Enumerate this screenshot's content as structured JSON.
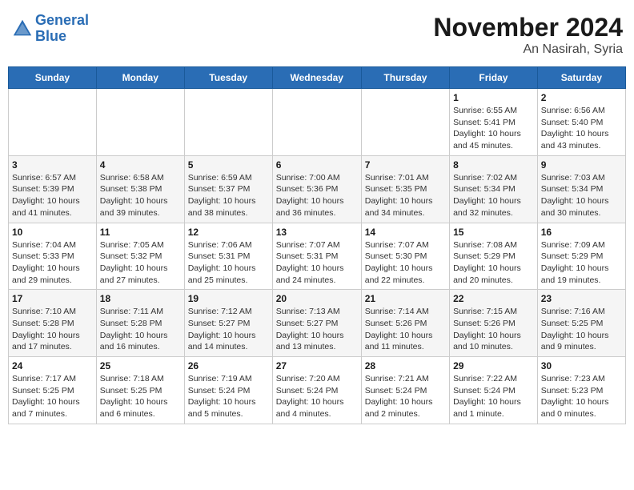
{
  "header": {
    "logo_line1": "General",
    "logo_line2": "Blue",
    "month": "November 2024",
    "location": "An Nasirah, Syria"
  },
  "weekdays": [
    "Sunday",
    "Monday",
    "Tuesday",
    "Wednesday",
    "Thursday",
    "Friday",
    "Saturday"
  ],
  "weeks": [
    [
      {
        "day": "",
        "info": ""
      },
      {
        "day": "",
        "info": ""
      },
      {
        "day": "",
        "info": ""
      },
      {
        "day": "",
        "info": ""
      },
      {
        "day": "",
        "info": ""
      },
      {
        "day": "1",
        "info": "Sunrise: 6:55 AM\nSunset: 5:41 PM\nDaylight: 10 hours\nand 45 minutes."
      },
      {
        "day": "2",
        "info": "Sunrise: 6:56 AM\nSunset: 5:40 PM\nDaylight: 10 hours\nand 43 minutes."
      }
    ],
    [
      {
        "day": "3",
        "info": "Sunrise: 6:57 AM\nSunset: 5:39 PM\nDaylight: 10 hours\nand 41 minutes."
      },
      {
        "day": "4",
        "info": "Sunrise: 6:58 AM\nSunset: 5:38 PM\nDaylight: 10 hours\nand 39 minutes."
      },
      {
        "day": "5",
        "info": "Sunrise: 6:59 AM\nSunset: 5:37 PM\nDaylight: 10 hours\nand 38 minutes."
      },
      {
        "day": "6",
        "info": "Sunrise: 7:00 AM\nSunset: 5:36 PM\nDaylight: 10 hours\nand 36 minutes."
      },
      {
        "day": "7",
        "info": "Sunrise: 7:01 AM\nSunset: 5:35 PM\nDaylight: 10 hours\nand 34 minutes."
      },
      {
        "day": "8",
        "info": "Sunrise: 7:02 AM\nSunset: 5:34 PM\nDaylight: 10 hours\nand 32 minutes."
      },
      {
        "day": "9",
        "info": "Sunrise: 7:03 AM\nSunset: 5:34 PM\nDaylight: 10 hours\nand 30 minutes."
      }
    ],
    [
      {
        "day": "10",
        "info": "Sunrise: 7:04 AM\nSunset: 5:33 PM\nDaylight: 10 hours\nand 29 minutes."
      },
      {
        "day": "11",
        "info": "Sunrise: 7:05 AM\nSunset: 5:32 PM\nDaylight: 10 hours\nand 27 minutes."
      },
      {
        "day": "12",
        "info": "Sunrise: 7:06 AM\nSunset: 5:31 PM\nDaylight: 10 hours\nand 25 minutes."
      },
      {
        "day": "13",
        "info": "Sunrise: 7:07 AM\nSunset: 5:31 PM\nDaylight: 10 hours\nand 24 minutes."
      },
      {
        "day": "14",
        "info": "Sunrise: 7:07 AM\nSunset: 5:30 PM\nDaylight: 10 hours\nand 22 minutes."
      },
      {
        "day": "15",
        "info": "Sunrise: 7:08 AM\nSunset: 5:29 PM\nDaylight: 10 hours\nand 20 minutes."
      },
      {
        "day": "16",
        "info": "Sunrise: 7:09 AM\nSunset: 5:29 PM\nDaylight: 10 hours\nand 19 minutes."
      }
    ],
    [
      {
        "day": "17",
        "info": "Sunrise: 7:10 AM\nSunset: 5:28 PM\nDaylight: 10 hours\nand 17 minutes."
      },
      {
        "day": "18",
        "info": "Sunrise: 7:11 AM\nSunset: 5:28 PM\nDaylight: 10 hours\nand 16 minutes."
      },
      {
        "day": "19",
        "info": "Sunrise: 7:12 AM\nSunset: 5:27 PM\nDaylight: 10 hours\nand 14 minutes."
      },
      {
        "day": "20",
        "info": "Sunrise: 7:13 AM\nSunset: 5:27 PM\nDaylight: 10 hours\nand 13 minutes."
      },
      {
        "day": "21",
        "info": "Sunrise: 7:14 AM\nSunset: 5:26 PM\nDaylight: 10 hours\nand 11 minutes."
      },
      {
        "day": "22",
        "info": "Sunrise: 7:15 AM\nSunset: 5:26 PM\nDaylight: 10 hours\nand 10 minutes."
      },
      {
        "day": "23",
        "info": "Sunrise: 7:16 AM\nSunset: 5:25 PM\nDaylight: 10 hours\nand 9 minutes."
      }
    ],
    [
      {
        "day": "24",
        "info": "Sunrise: 7:17 AM\nSunset: 5:25 PM\nDaylight: 10 hours\nand 7 minutes."
      },
      {
        "day": "25",
        "info": "Sunrise: 7:18 AM\nSunset: 5:25 PM\nDaylight: 10 hours\nand 6 minutes."
      },
      {
        "day": "26",
        "info": "Sunrise: 7:19 AM\nSunset: 5:24 PM\nDaylight: 10 hours\nand 5 minutes."
      },
      {
        "day": "27",
        "info": "Sunrise: 7:20 AM\nSunset: 5:24 PM\nDaylight: 10 hours\nand 4 minutes."
      },
      {
        "day": "28",
        "info": "Sunrise: 7:21 AM\nSunset: 5:24 PM\nDaylight: 10 hours\nand 2 minutes."
      },
      {
        "day": "29",
        "info": "Sunrise: 7:22 AM\nSunset: 5:24 PM\nDaylight: 10 hours\nand 1 minute."
      },
      {
        "day": "30",
        "info": "Sunrise: 7:23 AM\nSunset: 5:23 PM\nDaylight: 10 hours\nand 0 minutes."
      }
    ]
  ]
}
